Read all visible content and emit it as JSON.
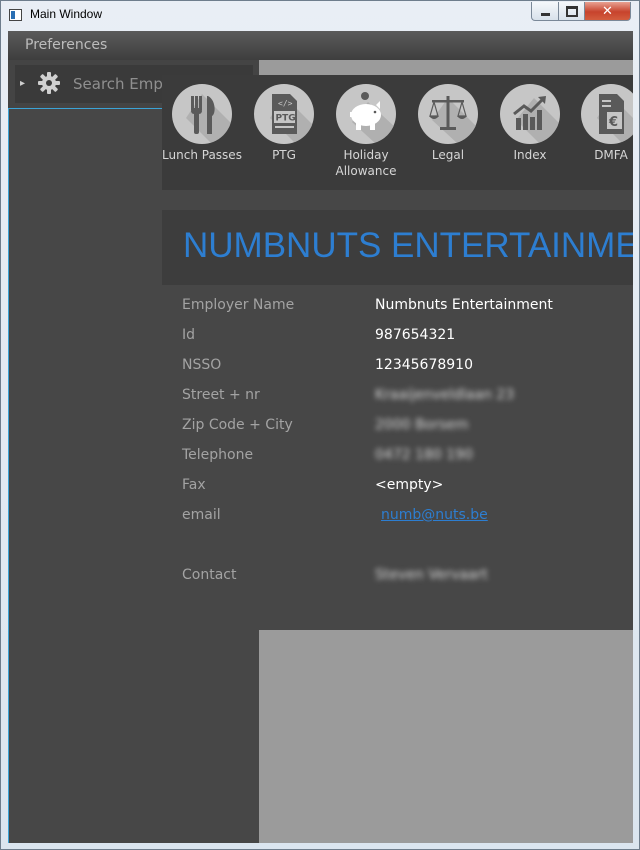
{
  "window": {
    "title": "Main Window",
    "close_glyph": "✕"
  },
  "menu": {
    "preferences": "Preferences"
  },
  "search": {
    "placeholder": "Search Emp",
    "expander": "▸"
  },
  "toolbar": {
    "items": [
      {
        "label": "Lunch Passes",
        "icon": "fork-knife-icon"
      },
      {
        "label": "PTG",
        "icon": "ptg-document-icon"
      },
      {
        "label": "Holiday Allowance",
        "icon": "piggy-bank-icon"
      },
      {
        "label": "Legal",
        "icon": "scales-icon"
      },
      {
        "label": "Index",
        "icon": "growth-chart-icon"
      },
      {
        "label": "DMFA",
        "icon": "euro-document-icon"
      }
    ],
    "ptg_badge": "PTG",
    "code_badge": "</>",
    "euro_badge": "€"
  },
  "employer": {
    "title": "NUMBNUTS ENTERTAINMENT",
    "fields": {
      "name": {
        "label": "Employer Name",
        "value": "Numbnuts Entertainment"
      },
      "id": {
        "label": "Id",
        "value": "987654321"
      },
      "nsso": {
        "label": "NSSO",
        "value": "12345678910"
      },
      "street": {
        "label": "Street + nr",
        "value": "Kraaijenveldlaan 23"
      },
      "zip": {
        "label": "Zip Code + City",
        "value": "2000 Borsem"
      },
      "phone": {
        "label": "Telephone",
        "value": "0472 180 190"
      },
      "fax": {
        "label": "Fax",
        "value": "<empty>"
      },
      "email": {
        "label": "email",
        "value": "numb@nuts.be"
      },
      "contact": {
        "label": "Contact",
        "value": "Steven Vervaart"
      }
    }
  },
  "colors": {
    "accent": "#2d7ed1",
    "focus_border": "#3ba3d6",
    "panel": "#474747",
    "toolbar": "#3b3b3b",
    "icon_circle": "#c6c6c6"
  }
}
